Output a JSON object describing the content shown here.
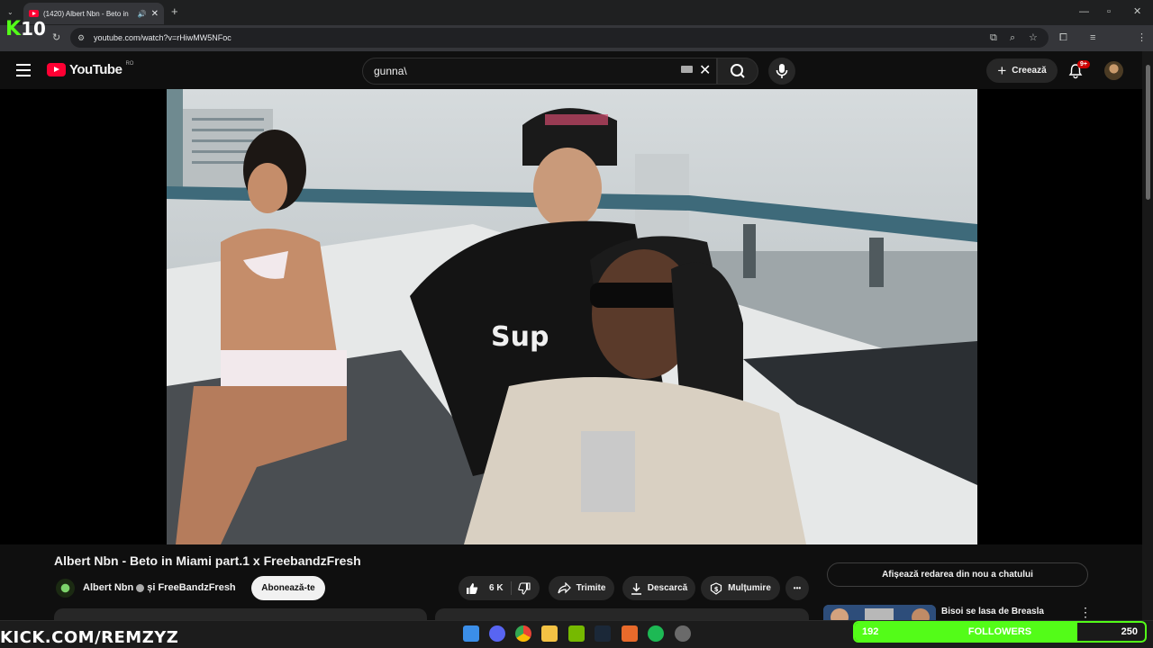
{
  "browser": {
    "tab_title": "(1420) Albert Nbn - Beto in",
    "new_tab": "+",
    "url": "youtube.com/watch?v=rHiwMW5NFoc"
  },
  "overlay": {
    "kick_logo_k": "K",
    "kick_logo_num": "10",
    "kick_url": "KICK.COM/REMZYZ",
    "followers_current": "192",
    "followers_label": "FOLLOWERS",
    "followers_goal": "250",
    "followers_progress": 0.768,
    "accent_color": "#53fc18"
  },
  "youtube": {
    "logo_text": "YouTube",
    "region": "RO",
    "search_value": "gunna\\",
    "create_label": "Creează",
    "notifications_badge": "9+"
  },
  "video": {
    "title": "Albert Nbn - Beto in Miami part.1 x FreebandzFresh",
    "channel": "Albert Nbn",
    "collab": "și FreeBandzFresh",
    "subscribe_label": "Abonează-te",
    "likes": "6 K",
    "share_label": "Trimite",
    "download_label": "Descarcă",
    "thanks_label": "Mulțumire",
    "more_label": "•••"
  },
  "sidebar": {
    "replay_chat_label": "Afișează redarea din nou a chatului",
    "rec_title": "Bisoi se lasa de Breasla"
  },
  "icons": {
    "menu": "hamburger-icon",
    "search": "search-icon",
    "mic": "microphone-icon",
    "bell": "bell-icon",
    "like": "thumbs-up-icon",
    "dislike": "thumbs-down-icon",
    "share": "share-arrow-icon",
    "download": "download-icon",
    "thanks": "thanks-icon"
  }
}
